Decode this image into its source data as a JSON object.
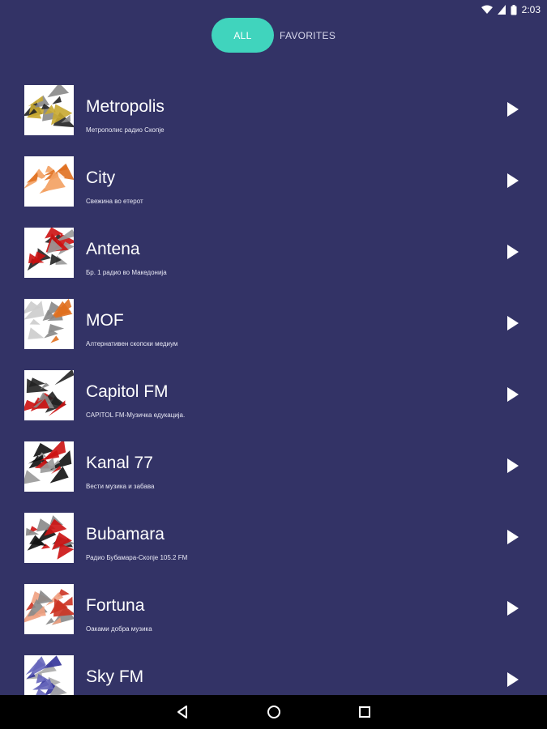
{
  "status": {
    "time": "2:03"
  },
  "tabs": [
    {
      "label": "ALL",
      "active": true
    },
    {
      "label": "FAVORITES",
      "active": false
    }
  ],
  "stations": [
    {
      "name": "Metropolis",
      "desc": "Метрополис радио Скопје",
      "logo_colors": [
        "#222222",
        "#c8a830",
        "#888888"
      ]
    },
    {
      "name": "City",
      "desc": "Свежина во етерот",
      "logo_colors": [
        "#e07020",
        "#f3a060",
        "#ffffff"
      ]
    },
    {
      "name": "Antena",
      "desc": "Бр. 1 радио во Македонија",
      "logo_colors": [
        "#222222",
        "#cc1111",
        "#999999"
      ]
    },
    {
      "name": "MOF",
      "desc": "Алтернативен скопски медиум",
      "logo_colors": [
        "#888888",
        "#e07020",
        "#cccccc"
      ]
    },
    {
      "name": "Capitol FM",
      "desc": "CAPITOL FM-Музичка едукација.",
      "logo_colors": [
        "#cc1111",
        "#222222",
        "#888888"
      ]
    },
    {
      "name": "Kanal 77",
      "desc": "Вести музика и забава",
      "logo_colors": [
        "#111111",
        "#999999",
        "#cc1111"
      ]
    },
    {
      "name": "Bubamara",
      "desc": "Радио Бубамара-Скопје 105.2 FM",
      "logo_colors": [
        "#cc1111",
        "#111111",
        "#888888"
      ]
    },
    {
      "name": "Fortuna",
      "desc": "Оаками добра музика",
      "logo_colors": [
        "#cc3322",
        "#f0a080",
        "#888888"
      ]
    },
    {
      "name": "Sky FM",
      "desc": "",
      "logo_colors": [
        "#333399",
        "#6666bb",
        "#aaaaaa"
      ]
    }
  ],
  "colors": {
    "background": "#333366",
    "accent": "#40d4bd",
    "nav_bar": "#000000"
  },
  "icons": {
    "play": "play-icon",
    "wifi": "wifi-icon",
    "signal": "signal-icon",
    "battery": "battery-icon",
    "back": "back-icon",
    "home": "home-icon",
    "recents": "recents-icon"
  }
}
